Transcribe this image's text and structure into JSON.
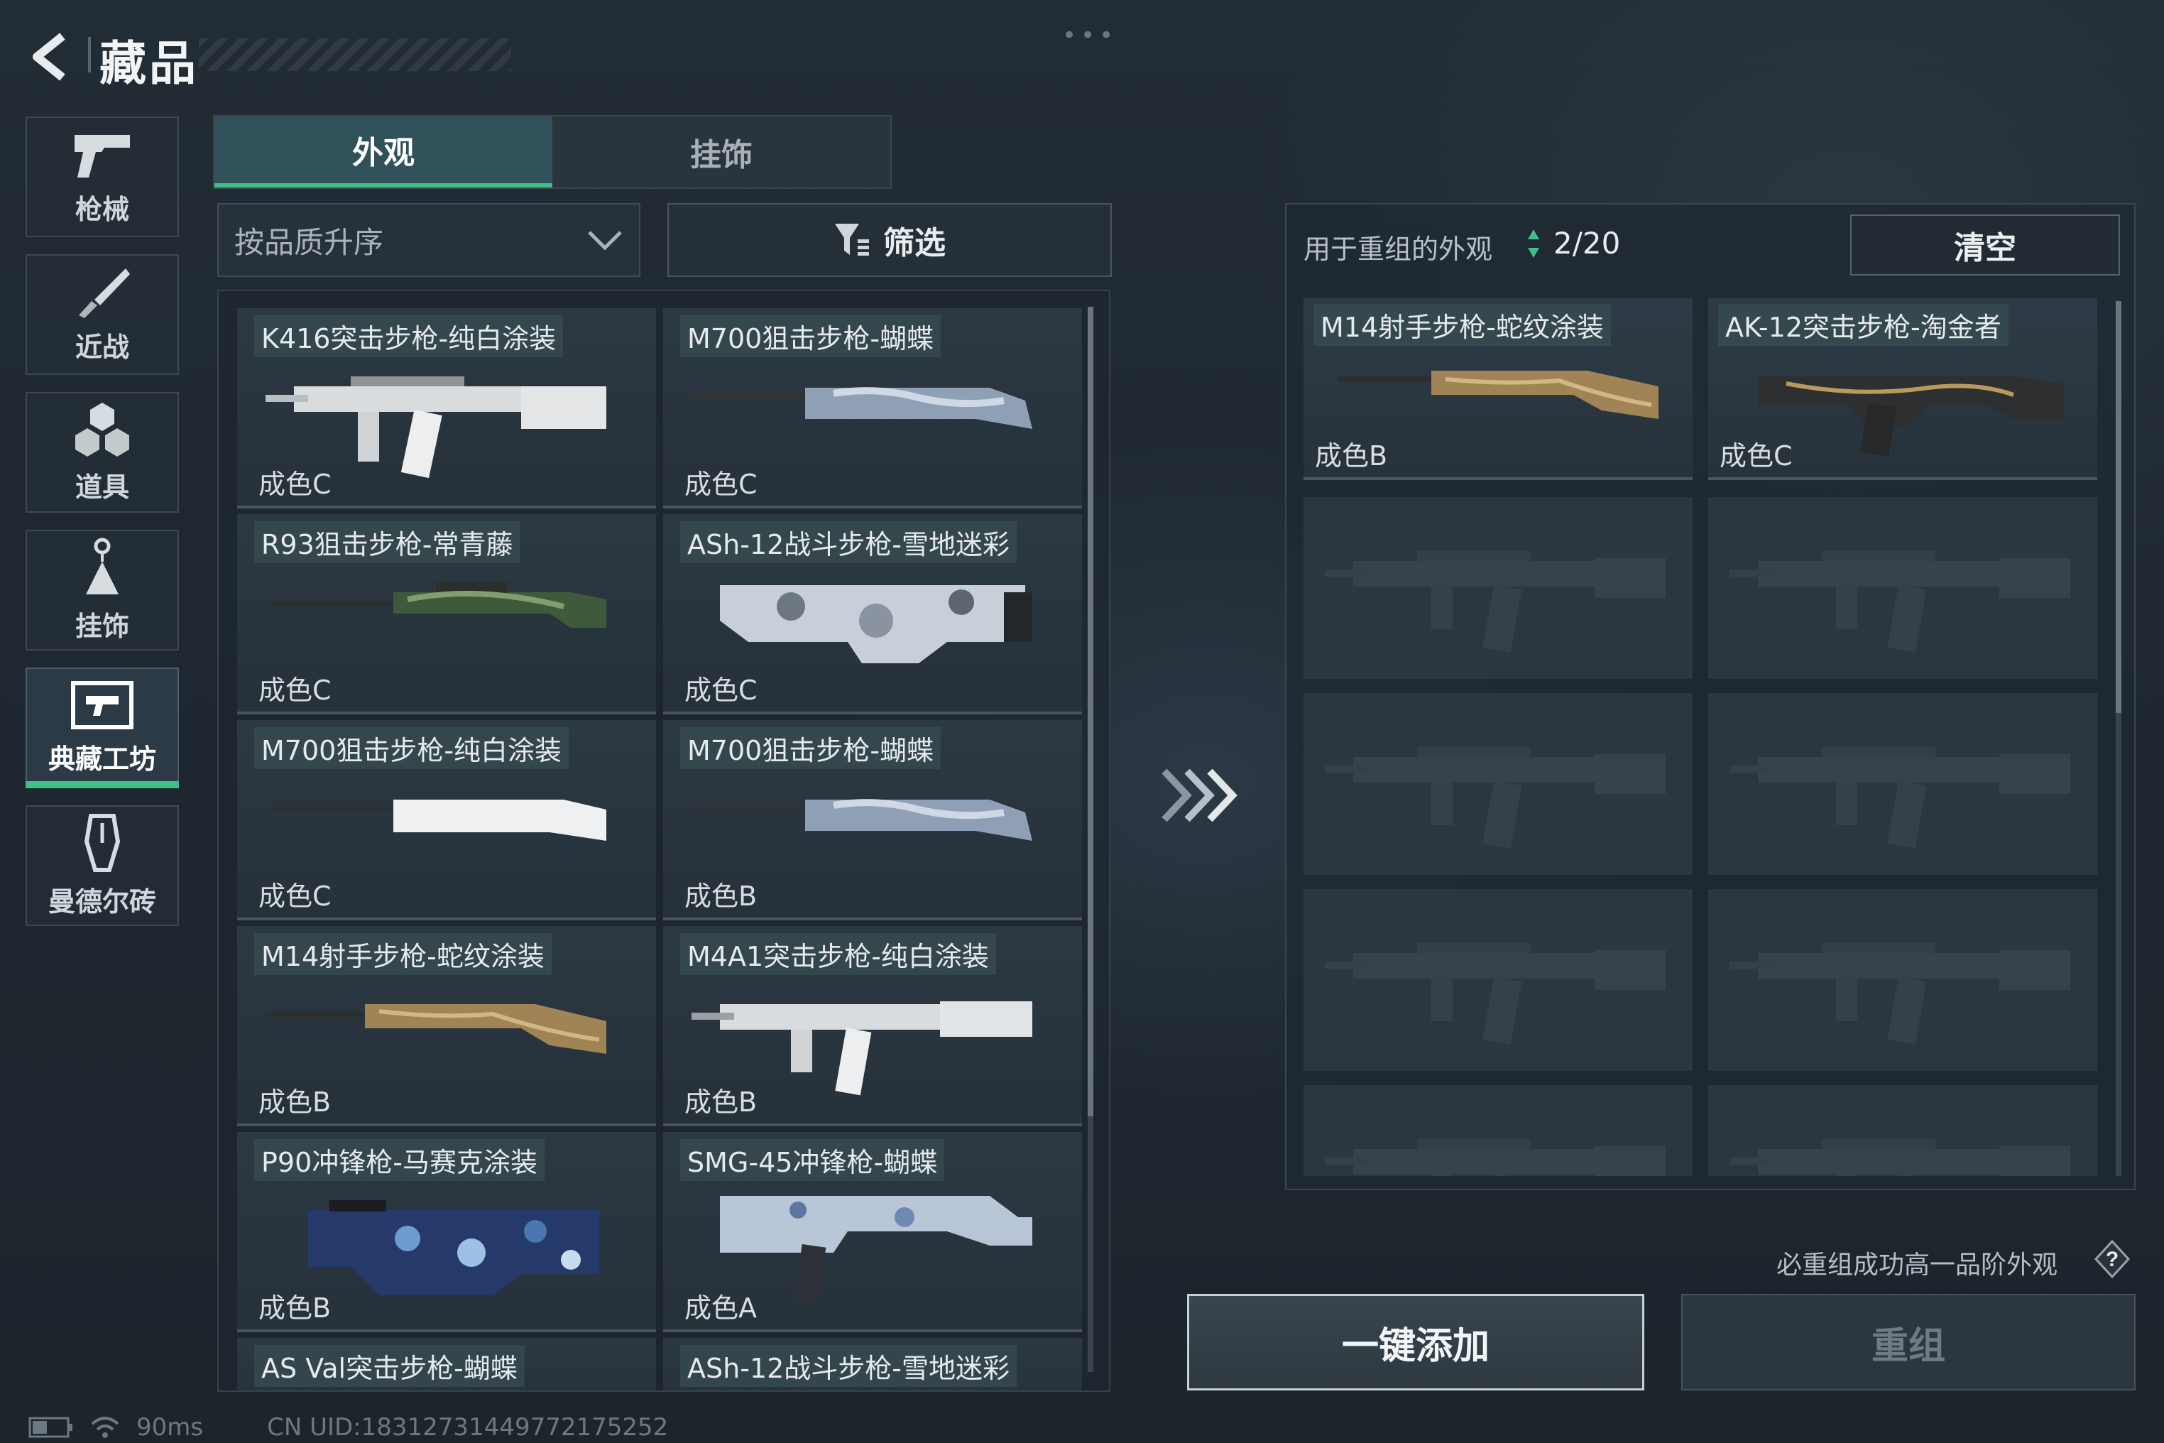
{
  "header": {
    "title": "藏品",
    "dots": "•••"
  },
  "nav": [
    {
      "label": "枪械",
      "icon": "pistol-icon"
    },
    {
      "label": "近战",
      "icon": "knife-icon"
    },
    {
      "label": "道具",
      "icon": "grenades-icon"
    },
    {
      "label": "挂饰",
      "icon": "charm-icon"
    },
    {
      "label": "典藏工坊",
      "icon": "workshop-icon",
      "active": true
    },
    {
      "label": "曼德尔砖",
      "icon": "mandel-brick-icon"
    }
  ],
  "tabs": [
    {
      "label": "外观",
      "active": true
    },
    {
      "label": "挂饰",
      "active": false
    }
  ],
  "sort": {
    "value": "按品质升序"
  },
  "filter": {
    "label": "筛选"
  },
  "grid": [
    {
      "name": "K416突击步枪-纯白涂装",
      "grade": "成色C"
    },
    {
      "name": "M700狙击步枪-蝴蝶",
      "grade": "成色C"
    },
    {
      "name": "R93狙击步枪-常青藤",
      "grade": "成色C"
    },
    {
      "name": "ASh-12战斗步枪-雪地迷彩",
      "grade": "成色C"
    },
    {
      "name": "M700狙击步枪-纯白涂装",
      "grade": "成色C"
    },
    {
      "name": "M700狙击步枪-蝴蝶",
      "grade": "成色B"
    },
    {
      "name": "M14射手步枪-蛇纹涂装",
      "grade": "成色B"
    },
    {
      "name": "M4A1突击步枪-纯白涂装",
      "grade": "成色B"
    },
    {
      "name": "P90冲锋枪-马赛克涂装",
      "grade": "成色B"
    },
    {
      "name": "SMG-45冲锋枪-蝴蝶",
      "grade": "成色A"
    },
    {
      "name": "AS Val突击步枪-蝴蝶",
      "grade": ""
    },
    {
      "name": "ASh-12战斗步枪-雪地迷彩",
      "grade": ""
    }
  ],
  "right": {
    "label": "用于重组的外观",
    "count": "2/20",
    "clear": "清空",
    "selected": [
      {
        "name": "M14射手步枪-蛇纹涂装",
        "grade": "成色B"
      },
      {
        "name": "AK-12突击步枪-淘金者",
        "grade": "成色C"
      }
    ],
    "hint": "必重组成功高一品阶外观",
    "help": "?",
    "oneclick": "一键添加",
    "regroup": "重组"
  },
  "status": {
    "ping": "90ms",
    "uid": "CN UID:18312731449772175252"
  },
  "colors": {
    "accent": "#3fbf8a",
    "panel": "#1f2831"
  }
}
